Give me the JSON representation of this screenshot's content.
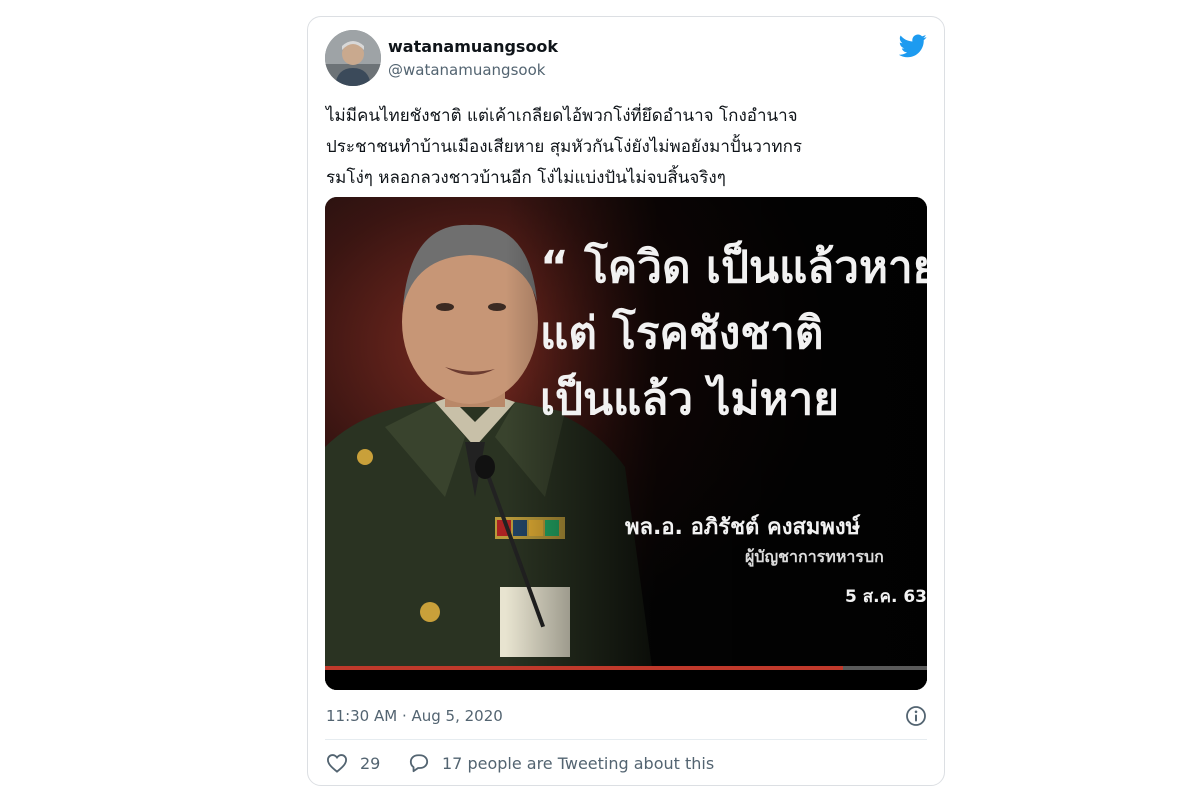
{
  "tweet": {
    "name": "watanamuangsook",
    "handle": "@watanamuangsook",
    "text": "ไม่มีคนไทยชังชาติ แต่เค้าเกลียดไอ้พวกโง่ที่ยึดอำนาจ โกงอำนาจ\nประชาชนทำบ้านเมืองเสียหาย สุมหัวกันโง่ยังไม่พอยังมาปั้นวาทกร\nรมโง่ๆ หลอกลวงชาวบ้านอีก โง่ไม่แบ่งปันไม่จบสิ้นจริงๆ",
    "timestamp": "11:30 AM · Aug 5, 2020",
    "likes": "29",
    "people_tweeting": "17 people are Tweeting about this",
    "icons": [
      "twitter-bird-icon",
      "info-icon",
      "heart-icon",
      "comment-icon"
    ],
    "brand_color": "#1d9bf0"
  },
  "media": {
    "quote": "“ โควิด เป็นแล้วหาย\nแต่ โรคชังชาติ\nเป็นแล้ว ไม่หาย",
    "caption_name": "พล.อ. อภิรัชต์ คงสมพงษ์",
    "caption_title": "ผู้บัญชาการทหารบก",
    "caption_date": "5 ส.ค. 63",
    "video_progress": 0.86
  }
}
